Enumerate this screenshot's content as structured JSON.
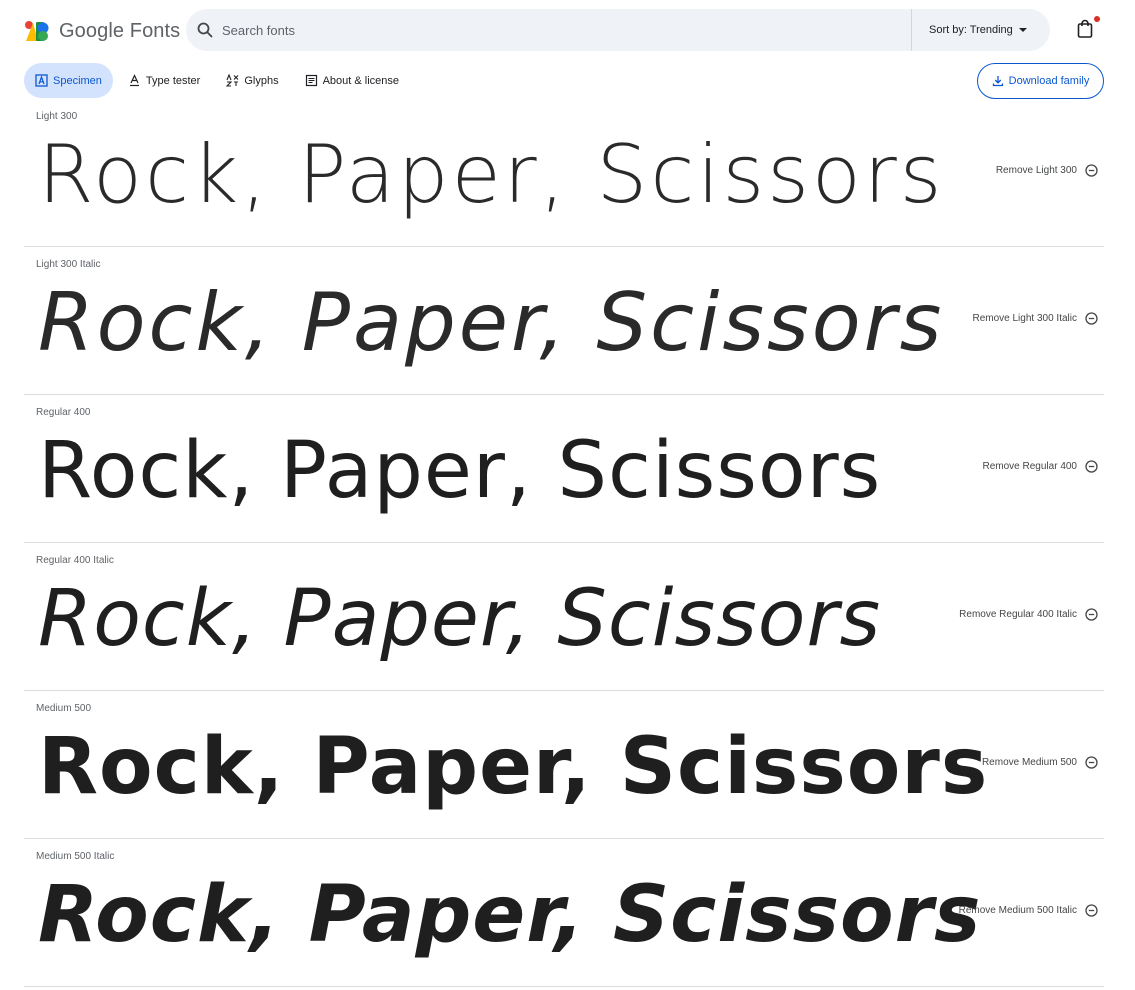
{
  "header": {
    "logo_text": "Google Fonts",
    "search_placeholder": "Search fonts",
    "sort_label": "Sort by: Trending"
  },
  "tabs": [
    {
      "label": "Specimen",
      "active": true,
      "icon": "specimen-icon"
    },
    {
      "label": "Type tester",
      "active": false,
      "icon": "type-tester-icon"
    },
    {
      "label": "Glyphs",
      "active": false,
      "icon": "glyphs-icon"
    },
    {
      "label": "About & license",
      "active": false,
      "icon": "about-icon"
    }
  ],
  "download_label": "Download family",
  "specimen_text": "Rock, Paper, Scissors",
  "styles": [
    {
      "label": "Light 300",
      "remove_label": "Remove Light 300"
    },
    {
      "label": "Light 300 Italic",
      "remove_label": "Remove Light 300 Italic"
    },
    {
      "label": "Regular 400",
      "remove_label": "Remove Regular 400"
    },
    {
      "label": "Regular 400 Italic",
      "remove_label": "Remove Regular 400 Italic"
    },
    {
      "label": "Medium 500",
      "remove_label": "Remove Medium 500"
    },
    {
      "label": "Medium 500 Italic",
      "remove_label": "Remove Medium 500 Italic"
    }
  ],
  "colors": {
    "accent": "#0b57d0",
    "active_tab_bg": "#d3e3fd",
    "search_bg": "#eff3f8",
    "notification_dot": "#d93025"
  }
}
